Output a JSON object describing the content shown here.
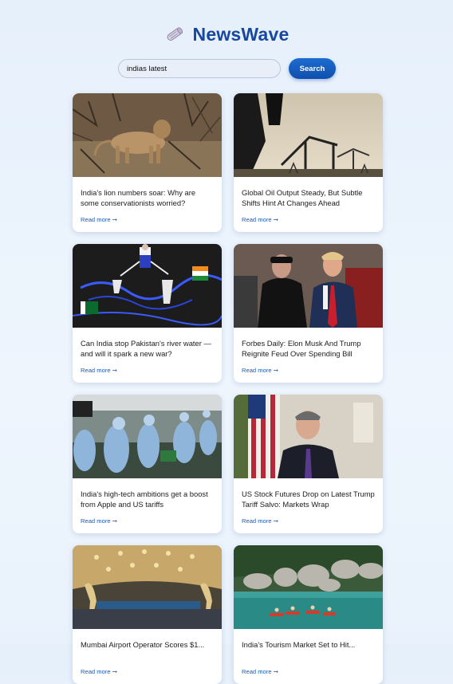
{
  "app": {
    "brand": "NewsWave"
  },
  "search": {
    "value": "indias latest",
    "button_label": "Search"
  },
  "articles": [
    {
      "title": "India's lion numbers soar: Why are some conservationists worried?",
      "link_label": "Read more ➞"
    },
    {
      "title": "Global Oil Output Steady, But Subtle Shifts Hint At Changes Ahead",
      "link_label": "Read more ➞"
    },
    {
      "title": "Can India stop Pakistan's river water — and will it spark a new war?",
      "link_label": "Read more ➞"
    },
    {
      "title": "Forbes Daily: Elon Musk And Trump Reignite Feud Over Spending Bill",
      "link_label": "Read more ➞"
    },
    {
      "title": "India's high-tech ambitions get a boost from Apple and US tariffs",
      "link_label": "Read more ➞"
    },
    {
      "title": "US Stock Futures Drop on Latest Trump Tariff Salvo: Markets Wrap",
      "link_label": "Read more ➞"
    },
    {
      "title": "Mumbai Airport Operator Scores $1...",
      "link_label": "Read more ➞"
    },
    {
      "title": "India's Tourism Market Set to Hit...",
      "link_label": "Read more ➞"
    }
  ]
}
